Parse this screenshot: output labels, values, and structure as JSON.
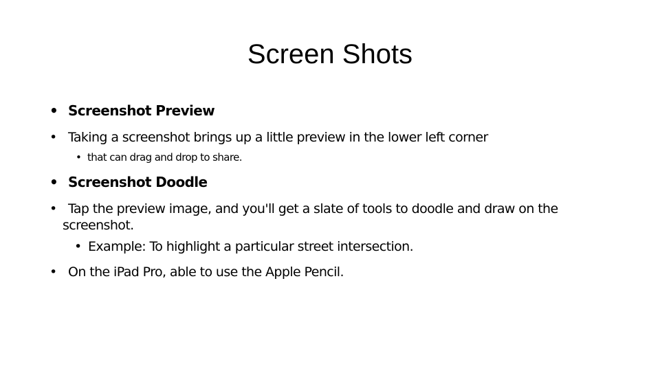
{
  "slide": {
    "title": "Screen Shots",
    "bullet_char": "•",
    "items": [
      {
        "level": 1,
        "bold": true,
        "text": "Screenshot Preview"
      },
      {
        "level": 1,
        "bold": false,
        "text": "Taking a screenshot brings up a little preview in the lower left corner"
      },
      {
        "level": 2,
        "bold": false,
        "text": "that can drag and drop to share."
      },
      {
        "level": 1,
        "bold": true,
        "text": "Screenshot Doodle"
      },
      {
        "level": 1,
        "bold": false,
        "text": "Tap the preview image, and you'll get a slate of tools to doodle and draw on the",
        "continuation": "screenshot."
      },
      {
        "level": 2,
        "bold": false,
        "text": "Example: To highlight a particular street intersection."
      },
      {
        "level": 1,
        "bold": false,
        "text": "On the iPad Pro, able to use the Apple Pencil."
      }
    ]
  }
}
